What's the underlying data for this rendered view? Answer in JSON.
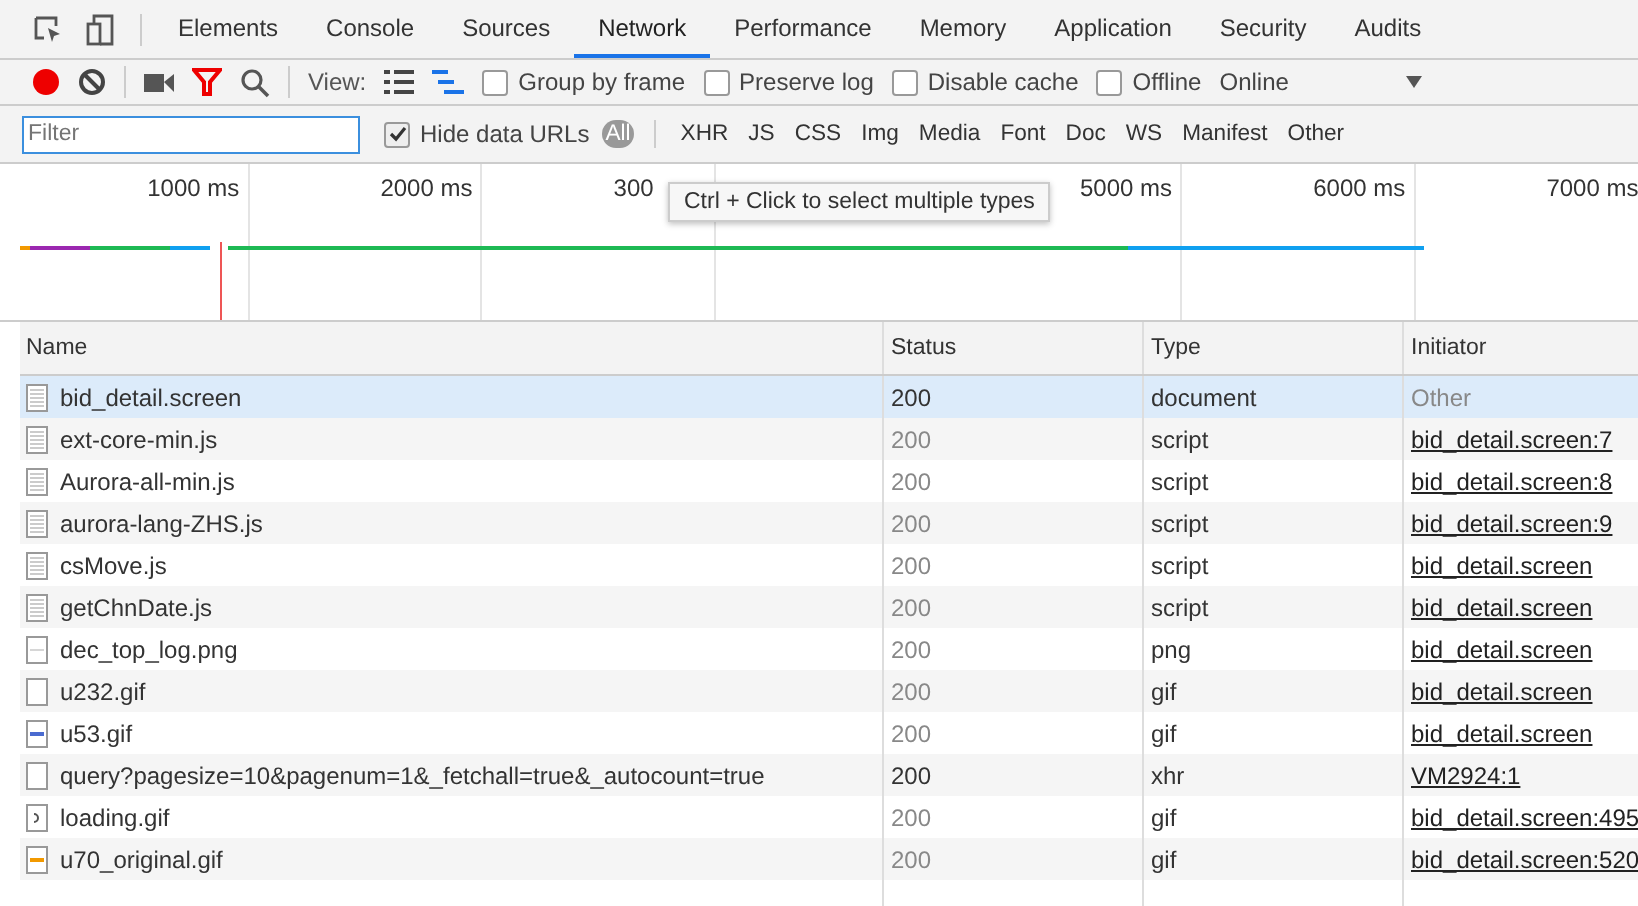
{
  "tabs": [
    {
      "label": "Elements",
      "selected": false
    },
    {
      "label": "Console",
      "selected": false
    },
    {
      "label": "Sources",
      "selected": false
    },
    {
      "label": "Network",
      "selected": true
    },
    {
      "label": "Performance",
      "selected": false
    },
    {
      "label": "Memory",
      "selected": false
    },
    {
      "label": "Application",
      "selected": false
    },
    {
      "label": "Security",
      "selected": false
    },
    {
      "label": "Audits",
      "selected": false
    }
  ],
  "toolbar": {
    "recording": true,
    "filter_active": true,
    "view_label": "View:",
    "group_by_frame": {
      "label": "Group by frame",
      "checked": false
    },
    "preserve_log": {
      "label": "Preserve log",
      "checked": false
    },
    "disable_cache": {
      "label": "Disable cache",
      "checked": false
    },
    "offline": {
      "label": "Offline",
      "checked": false
    },
    "throttle": "Online"
  },
  "filter_bar": {
    "placeholder": "Filter",
    "hide_data_urls": {
      "label": "Hide data URLs",
      "checked": true
    },
    "types": [
      {
        "label": "All",
        "selected": true
      },
      {
        "label": "XHR",
        "selected": false
      },
      {
        "label": "JS",
        "selected": false
      },
      {
        "label": "CSS",
        "selected": false
      },
      {
        "label": "Img",
        "selected": false
      },
      {
        "label": "Media",
        "selected": false
      },
      {
        "label": "Font",
        "selected": false
      },
      {
        "label": "Doc",
        "selected": false
      },
      {
        "label": "WS",
        "selected": false
      },
      {
        "label": "Manifest",
        "selected": false
      },
      {
        "label": "Other",
        "selected": false
      }
    ]
  },
  "tooltip": "Ctrl + Click to select multiple types",
  "timeline": {
    "ticks": [
      "1000 ms",
      "2000 ms",
      "300",
      "5000 ms",
      "6000 ms",
      "7000 ms"
    ]
  },
  "table": {
    "columns": [
      "Name",
      "Status",
      "Type",
      "Initiator"
    ],
    "rows": [
      {
        "name": "bid_detail.screen",
        "kind": "text",
        "status": "200",
        "type": "document",
        "initiator": "Other",
        "initiator_link": false,
        "selected": true,
        "dimmed": false
      },
      {
        "name": "ext-core-min.js",
        "kind": "text",
        "status": "200",
        "type": "script",
        "initiator": "bid_detail.screen:7",
        "initiator_link": true,
        "selected": false,
        "dimmed": true
      },
      {
        "name": "Aurora-all-min.js",
        "kind": "text",
        "status": "200",
        "type": "script",
        "initiator": "bid_detail.screen:8",
        "initiator_link": true,
        "selected": false,
        "dimmed": true
      },
      {
        "name": "aurora-lang-ZHS.js",
        "kind": "text",
        "status": "200",
        "type": "script",
        "initiator": "bid_detail.screen:9",
        "initiator_link": true,
        "selected": false,
        "dimmed": true
      },
      {
        "name": "csMove.js",
        "kind": "text",
        "status": "200",
        "type": "script",
        "initiator": "bid_detail.screen",
        "initiator_link": true,
        "selected": false,
        "dimmed": true
      },
      {
        "name": "getChnDate.js",
        "kind": "text",
        "status": "200",
        "type": "script",
        "initiator": "bid_detail.screen",
        "initiator_link": true,
        "selected": false,
        "dimmed": true
      },
      {
        "name": "dec_top_log.png",
        "kind": "image",
        "status": "200",
        "type": "png",
        "initiator": "bid_detail.screen",
        "initiator_link": true,
        "selected": false,
        "dimmed": true
      },
      {
        "name": "u232.gif",
        "kind": "blank",
        "status": "200",
        "type": "gif",
        "initiator": "bid_detail.screen",
        "initiator_link": true,
        "selected": false,
        "dimmed": true
      },
      {
        "name": "u53.gif",
        "kind": "image",
        "status": "200",
        "type": "gif",
        "initiator": "bid_detail.screen",
        "initiator_link": true,
        "selected": false,
        "dimmed": true
      },
      {
        "name": "query?pagesize=10&pagenum=1&_fetchall=true&_autocount=true",
        "kind": "blank",
        "status": "200",
        "type": "xhr",
        "initiator": "VM2924:1",
        "initiator_link": true,
        "selected": false,
        "dimmed": false
      },
      {
        "name": "loading.gif",
        "kind": "image",
        "status": "200",
        "type": "gif",
        "initiator": "bid_detail.screen:495",
        "initiator_link": true,
        "selected": false,
        "dimmed": true
      },
      {
        "name": "u70_original.gif",
        "kind": "image",
        "status": "200",
        "type": "gif",
        "initiator": "bid_detail.screen:520",
        "initiator_link": true,
        "selected": false,
        "dimmed": true
      }
    ]
  }
}
